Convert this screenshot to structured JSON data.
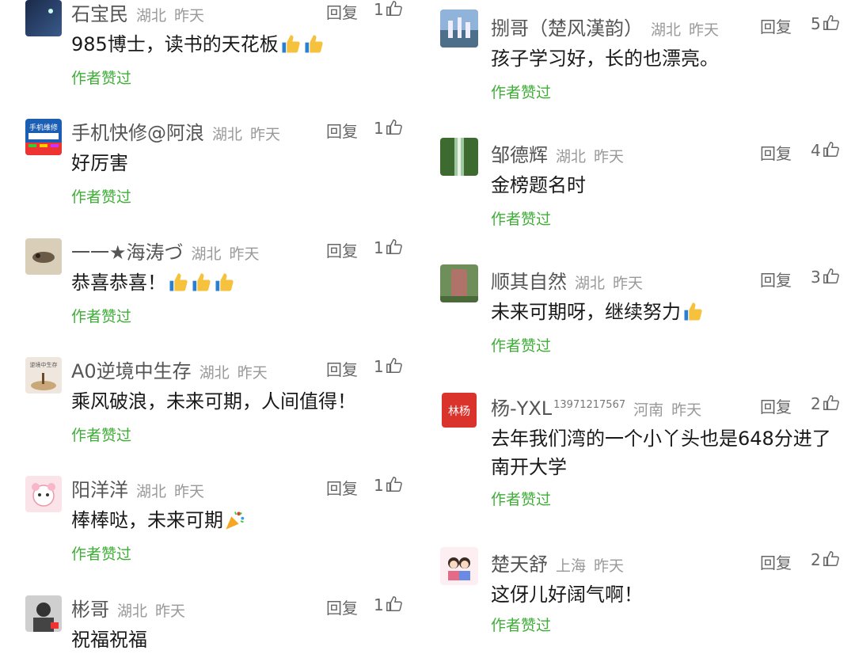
{
  "left_comments": [
    {
      "name": "石宝民",
      "location": "湖北",
      "time": "昨天",
      "reply": "回复",
      "likes": "1",
      "text": "985博士，读书的天花板",
      "liked": "作者赞过",
      "emoji": "thumbs-up"
    },
    {
      "name": "手机快修@阿浪",
      "location": "湖北",
      "time": "昨天",
      "reply": "回复",
      "likes": "1",
      "text": "好厉害",
      "liked": "作者赞过"
    },
    {
      "name": "一一★海涛づ",
      "location": "湖北",
      "time": "昨天",
      "reply": "回复",
      "likes": "1",
      "text": "恭喜恭喜！",
      "liked": "作者赞过",
      "emoji": "thumbs-up"
    },
    {
      "name": "A0逆境中生存",
      "location": "湖北",
      "time": "昨天",
      "reply": "回复",
      "likes": "1",
      "text": "乘风破浪，未来可期，人间值得！",
      "liked": "作者赞过"
    },
    {
      "name": "阳洋洋",
      "location": "湖北",
      "time": "昨天",
      "reply": "回复",
      "likes": "1",
      "text": "棒棒哒，未来可期",
      "liked": "作者赞过",
      "emoji": "party-popper"
    },
    {
      "name": "彬哥",
      "location": "湖北",
      "time": "昨天",
      "reply": "回复",
      "likes": "1",
      "text": "祝福祝福",
      "liked": ""
    }
  ],
  "right_comments": [
    {
      "name": "捌哥（楚风漢韵）",
      "location": "湖北",
      "time": "昨天",
      "reply": "回复",
      "likes": "5",
      "text": "孩子学习好，长的也漂亮。",
      "liked": "作者赞过"
    },
    {
      "name": "邹德辉",
      "location": "湖北",
      "time": "昨天",
      "reply": "回复",
      "likes": "4",
      "text": "金榜题名时",
      "liked": "作者赞过"
    },
    {
      "name": "顺其自然",
      "location": "湖北",
      "time": "昨天",
      "reply": "回复",
      "likes": "3",
      "text": "未来可期呀，继续努力",
      "liked": "作者赞过",
      "emoji": "thumbs-up"
    },
    {
      "name": "杨-YXL",
      "phone": "13971217567",
      "location": "河南",
      "time": "昨天",
      "reply": "回复",
      "likes": "2",
      "text": "去年我们湾的一个小丫头也是648分进了南开大学",
      "liked": "作者赞过"
    },
    {
      "name": "楚天舒",
      "location": "上海",
      "time": "昨天",
      "reply": "回复",
      "likes": "2",
      "text": "这伢儿好阔气啊！",
      "liked": "作者赞过"
    }
  ],
  "avatar_text": {
    "left_2": "手机维修",
    "left_4": "逆境中生存",
    "right_4": "林杨"
  },
  "colors": {
    "liked": "#3fae37",
    "meta": "#999999",
    "name": "#555555",
    "text": "#1a1a1a"
  }
}
